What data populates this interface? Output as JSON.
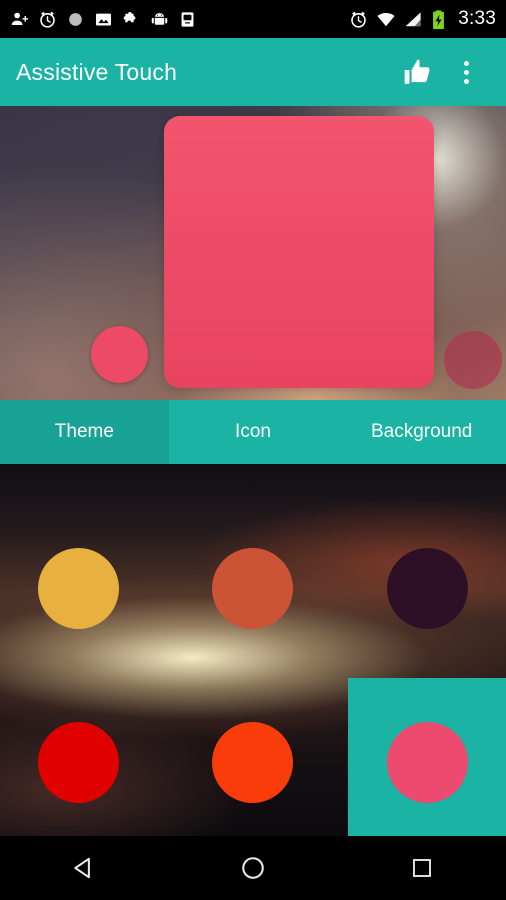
{
  "status_bar": {
    "icons": [
      "person-add-icon",
      "alarm-clock-icon",
      "brightness-icon",
      "photo-icon",
      "puzzle-icon",
      "android-icon",
      "sd-card-icon"
    ],
    "right_icons": [
      "alarm-icon",
      "wifi-icon",
      "signal-icon",
      "battery-charging-icon"
    ],
    "time": "3:33"
  },
  "app_bar": {
    "title": "Assistive Touch",
    "actions": [
      {
        "name": "thumbs-up-icon",
        "label": "Rate"
      },
      {
        "name": "overflow-menu-icon",
        "label": "More options"
      }
    ]
  },
  "preview": {
    "square_color": "#ec4a66",
    "left_dot_color": "#ec4a66",
    "right_dot_color": "#aa3750"
  },
  "tabs": [
    {
      "label": "Theme",
      "selected": true
    },
    {
      "label": "Icon",
      "selected": false
    },
    {
      "label": "Background",
      "selected": false
    }
  ],
  "theme_grid": {
    "accent": "#1ab3a4",
    "swatches": [
      {
        "name": "swatch-amber",
        "color": "#e8b13f",
        "selected": false
      },
      {
        "name": "swatch-burnt-orange",
        "color": "#cc5436",
        "selected": false
      },
      {
        "name": "swatch-dark-plum",
        "color": "#2d0f26",
        "selected": false
      },
      {
        "name": "swatch-red",
        "color": "#e00000",
        "selected": false
      },
      {
        "name": "swatch-orange-red",
        "color": "#fa3c0a",
        "selected": false
      },
      {
        "name": "swatch-pink",
        "color": "#ec4a6e",
        "selected": true
      }
    ]
  },
  "nav_bar": {
    "buttons": [
      {
        "name": "back-button",
        "label": "Back"
      },
      {
        "name": "home-button",
        "label": "Home"
      },
      {
        "name": "recents-button",
        "label": "Recent apps"
      }
    ]
  }
}
